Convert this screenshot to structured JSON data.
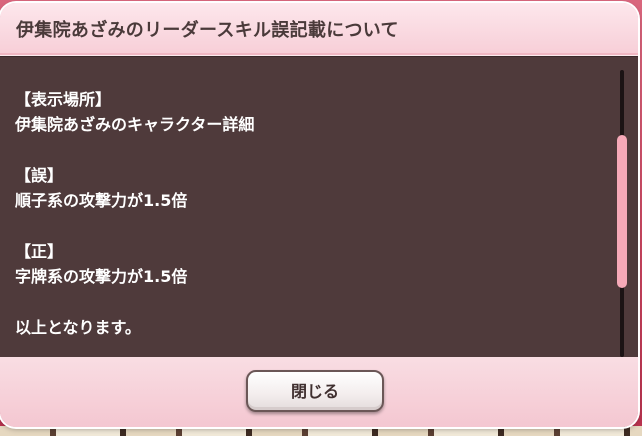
{
  "dialog": {
    "title": "伊集院あざみのリーダースキル誤記載について",
    "body": [
      "【表示場所】",
      "伊集院あざみのキャラクター詳細",
      "",
      "【誤】",
      "順子系の攻撃力が1.5倍",
      "",
      "【正】",
      "字牌系の攻撃力が1.5倍",
      "",
      "以上となります。"
    ],
    "close_label": "閉じる"
  },
  "colors": {
    "content_background": "#4f3a3b",
    "dialog_pink": "#f8d9e0",
    "scroll_thumb": "#f6a9b8",
    "text": "#ffffff"
  }
}
